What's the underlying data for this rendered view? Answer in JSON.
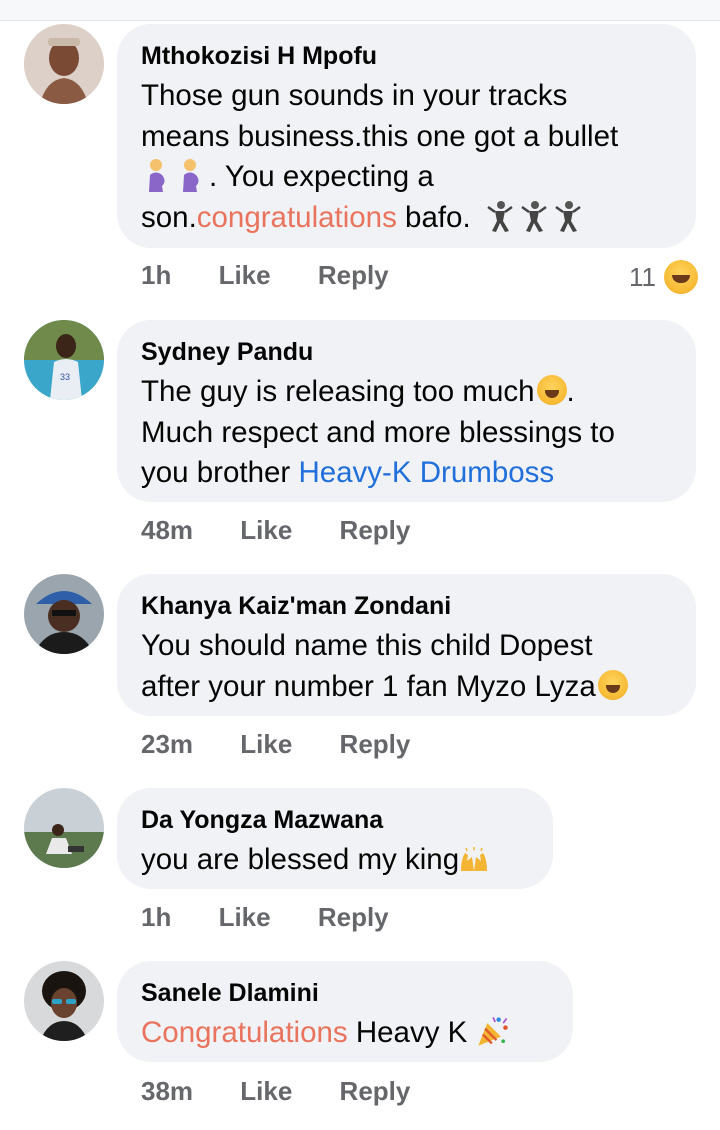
{
  "comments": [
    {
      "author": "Mthokozisi H Mpofu",
      "lines": [
        {
          "a": "Those gun sounds in your tracks"
        },
        {
          "a": "means business.this one got a bullet"
        },
        {
          "a": ". You expecting a"
        },
        {
          "a": "son.",
          "hl": "congratulations",
          "b": " bafo."
        }
      ],
      "time": "1h",
      "like": "Like",
      "reply": "Reply",
      "reaction_count": "11"
    },
    {
      "author": "Sydney Pandu",
      "lines": [
        {
          "a": "The guy is releasing too much",
          "b": "."
        },
        {
          "a": "Much respect and more blessings to"
        },
        {
          "a": "you brother ",
          "hl": "Heavy-K Drumboss"
        }
      ],
      "time": "48m",
      "like": "Like",
      "reply": "Reply"
    },
    {
      "author": "Khanya Kaiz'man Zondani",
      "lines": [
        {
          "a": "You should name this child Dopest"
        },
        {
          "a": "after your number 1 fan Myzo Lyza"
        }
      ],
      "time": "23m",
      "like": "Like",
      "reply": "Reply"
    },
    {
      "author": "Da Yongza Mazwana",
      "lines": [
        {
          "a": "you are blessed my king"
        }
      ],
      "time": "1h",
      "like": "Like",
      "reply": "Reply"
    },
    {
      "author": "Sanele Dlamini",
      "lines": [
        {
          "hl": "Congratulations",
          "b": " Heavy K "
        }
      ],
      "time": "38m",
      "like": "Like",
      "reply": "Reply"
    }
  ],
  "colors": {
    "bubble": "#f0f2f5",
    "mention_orange": "#e9735c",
    "mention_blue": "#216fdb",
    "meta_gray": "#65676b"
  },
  "icons": [
    "avatar",
    "pregnant-woman-emoji",
    "dancing-emoji",
    "laughing-tears-emoji",
    "grinning-emoji",
    "raised-hands-emoji",
    "party-popper-emoji",
    "laughing-reaction-icon"
  ]
}
